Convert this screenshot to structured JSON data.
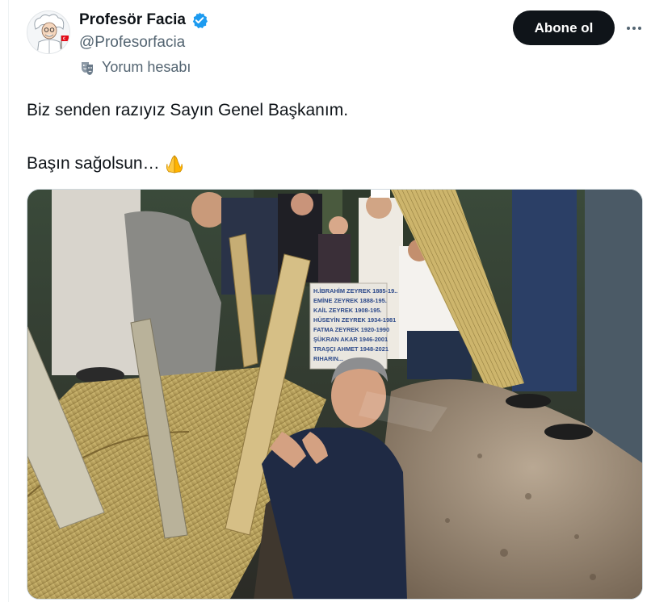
{
  "author": {
    "display_name": "Profesör Facia",
    "handle": "@Profesorfacia",
    "label": "Yorum hesabı",
    "verified": true,
    "verified_color": "#1d9bf0"
  },
  "actions": {
    "follow_label": "Abone ol"
  },
  "tweet": {
    "line1": "Biz senden razıyız Sayın Genel Başkanım.",
    "line2": "Başın sağolsun…"
  },
  "media": {
    "alt": "Photo",
    "gravestone_lines": [
      "H.İBRAHİM ZEYREK 1885-19..",
      "EMİNE ZEYREK 1888-195.",
      "KAİL ZEYREK 1908-195.",
      "HÜSEYİN ZEYREK 1934-1981",
      "FATMA ZEYREK 1920-1990",
      "ŞÜKRAN AKAR 1946-2001",
      "TRAŞÇI AHMET 1948-2021",
      "RIHARIN..."
    ]
  },
  "icons": {
    "verified": "verified-badge-icon",
    "label": "theater-mask-icon",
    "emoji": "folded-hands-emoji",
    "more": "more-horizontal-icon"
  }
}
